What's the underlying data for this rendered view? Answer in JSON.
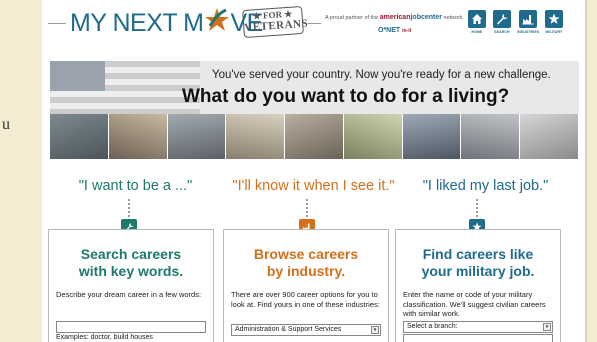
{
  "header": {
    "logo_text": "MY NEXT M",
    "logo_text_end": "VE",
    "stamp_for": "★ FOR ★",
    "stamp_veterans": "VETERANS",
    "partner_prefix": "A proud partner of the ",
    "partner_american": "american",
    "partner_jobcenter": "jobcenter",
    "partner_suffix": " network",
    "onet": "O*NET",
    "onet_sub": "in-it",
    "nav": [
      {
        "label": "HOME",
        "icon": "house-icon"
      },
      {
        "label": "SEARCH",
        "icon": "wrench-icon"
      },
      {
        "label": "INDUSTRIES",
        "icon": "industries-icon"
      },
      {
        "label": "MILITARY",
        "icon": "star-icon"
      }
    ]
  },
  "hero": {
    "subtitle": "You've served your country. Now you're ready for a new challenge.",
    "title": "What do you want to do for a living?"
  },
  "columns": [
    {
      "slogan": "\"I want to be a ...\"",
      "title_line1": "Search careers",
      "title_line2": "with key words.",
      "description": "Describe your dream career in a few words:",
      "input_value": "",
      "example": "Examples: doctor, build houses",
      "color": "#1e7a6a",
      "icon": "wrench-icon"
    },
    {
      "slogan": "\"I'll know it when I see it.\"",
      "title_line1": "Browse careers",
      "title_line2": "by industry.",
      "description": "There are over 900 career options for you to look at. Find yours in one of these industries:",
      "select_value": "Administration & Support Services",
      "color": "#d3701c",
      "icon": "industries-icon"
    },
    {
      "slogan": "\"I liked my last job.\"",
      "title_line1": "Find careers like",
      "title_line2": "your military job.",
      "description": "Enter the name or code of your military classification. We'll suggest civilian careers with similar work.",
      "select_value": "Select a branch:",
      "color": "#1f6b8e",
      "icon": "star-icon"
    }
  ],
  "edge_char": "u",
  "colors": {
    "primary": "#1f6b8e",
    "green": "#1e7a6a",
    "orange": "#d3701c",
    "red": "#a0152d"
  }
}
